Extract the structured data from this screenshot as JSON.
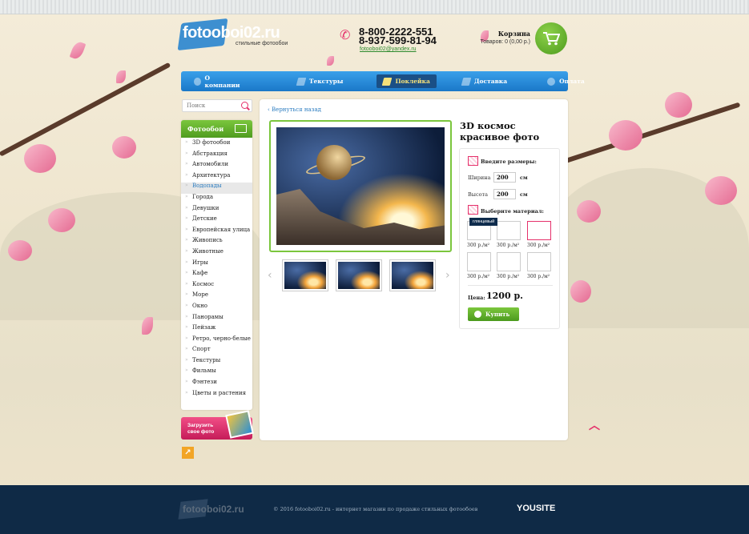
{
  "brand": {
    "logo_main": "fotooboi02.ru",
    "logo_dark": "oboi02",
    "tagline": "стильные фотообои"
  },
  "contacts": {
    "phone1": "8-800-2222-551",
    "phone2": "8-937-599-81-94",
    "email": "fotooboi02@yandex.ru"
  },
  "cart": {
    "title": "Корзина",
    "info": "Товаров: 0 (0,00 р.)"
  },
  "nav": [
    {
      "label": "О компании",
      "icon": "info-icon"
    },
    {
      "label": "Текстуры",
      "icon": "texture-icon"
    },
    {
      "label": "Поклейка",
      "icon": "paint-roller-icon",
      "active": true
    },
    {
      "label": "Доставка",
      "icon": "truck-icon"
    },
    {
      "label": "Оплата",
      "icon": "payment-icon"
    }
  ],
  "search": {
    "placeholder": "Поиск"
  },
  "sidebar": {
    "title": "Фотообои",
    "items": [
      "3D фотообои",
      "Абстракция",
      "Автомобили",
      "Архитектура",
      "Водопады",
      "Города",
      "Девушки",
      "Детские",
      "Европейская улица",
      "Живопись",
      "Животные",
      "Игры",
      "Кафе",
      "Космос",
      "Море",
      "Окно",
      "Панорамы",
      "Пейзаж",
      "Ретро, черно-белые",
      "Спорт",
      "Текстуры",
      "Фильмы",
      "Фэнтези",
      "Цветы и растения"
    ],
    "active_index": 4
  },
  "upload": {
    "label": "Загрузить свое фото"
  },
  "product": {
    "back": "Вернуться назад",
    "title": "3D космос красивое фото",
    "sizes_title": "Введите размеры:",
    "width_label": "Ширина",
    "width_value": "200",
    "height_label": "Высота",
    "height_value": "200",
    "unit": "см",
    "material_title": "Выберите материал:",
    "tooltip": "глянцевый",
    "material_prices": [
      "300 р./м²",
      "300 р./м²",
      "300 р./м²",
      "300 р./м²",
      "300 р./м²",
      "300 р./м²"
    ],
    "selected_material": 2,
    "price_label": "Цена:",
    "price_value": "1200 р.",
    "buy_label": "Купить"
  },
  "footer": {
    "logo": "fotooboi02.ru",
    "copyright": "© 2016 fotooboi02.ru - интернет магазин по продаже стильных фотообоев",
    "dev": "YOUSITE"
  },
  "colors": {
    "accent_green": "#6cb52f",
    "nav_blue": "#2a8ad8",
    "accent_pink": "#e5316b",
    "footer": "#0f2a46"
  }
}
